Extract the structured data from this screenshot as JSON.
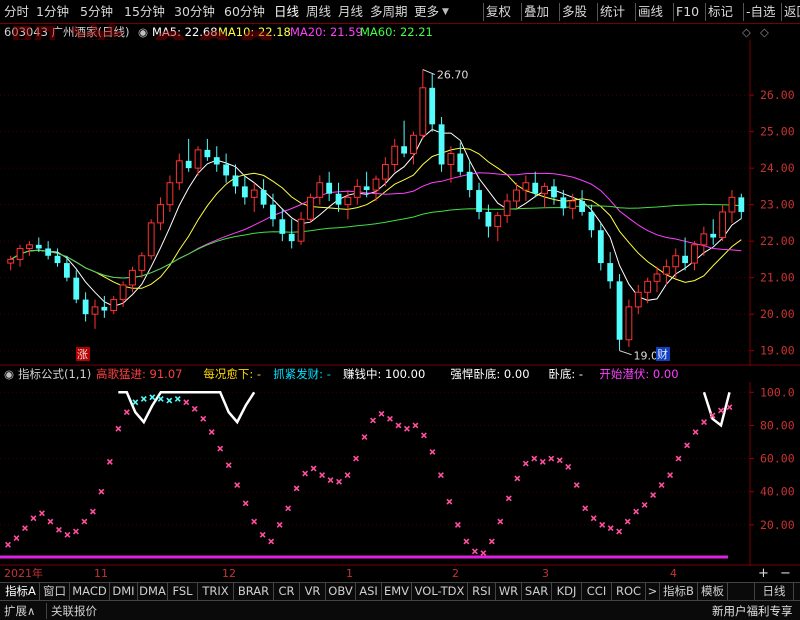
{
  "toolbar": {
    "items": [
      "分时",
      "1分钟",
      "5分钟",
      "15分钟",
      "30分钟",
      "60分钟",
      "日线",
      "周线",
      "月线",
      "多周期",
      "更多"
    ],
    "right_items": [
      "复权",
      "叠加",
      "多股",
      "统计",
      "画线",
      "F10",
      "标记",
      "-自选",
      "返回"
    ]
  },
  "stock": {
    "code_name": "603043 广州酒家(日线)",
    "ma5": "MA5: 22.68",
    "ma10": "MA10: 22.18",
    "ma20": "MA20: 21.59",
    "ma60": "MA60: 22.21"
  },
  "watermark": "股道 908.cn",
  "price_axis": [
    "26.00",
    "25.00",
    "24.00",
    "23.00",
    "22.00",
    "21.00",
    "20.00",
    "19.00"
  ],
  "annotations": {
    "high": "26.70",
    "low": "19.00",
    "zhang": "涨",
    "cai": "财"
  },
  "indicator": {
    "title": "指标公式(1,1)",
    "parts": [
      {
        "label": "高歌猛进:",
        "value": "91.07",
        "color": "#ff4040"
      },
      {
        "label": "每况愈下:",
        "value": "-",
        "color": "#ffd700"
      },
      {
        "label": "抓紧发财:",
        "value": "-",
        "color": "#00e0ff"
      },
      {
        "label": "赚钱中:",
        "value": "100.00",
        "color": "#ffffff"
      },
      {
        "label": "强悍卧底:",
        "value": "0.00",
        "color": "#ffffff"
      },
      {
        "label": "卧底:",
        "value": "-",
        "color": "#ffffff"
      },
      {
        "label": "开始潜伏:",
        "value": "0.00",
        "color": "#ff40ff"
      }
    ],
    "axis": [
      "100.0",
      "80.00",
      "60.00",
      "40.00",
      "20.00"
    ]
  },
  "time_axis": [
    "2021年",
    "11",
    "12",
    "1",
    "2",
    "3",
    "4"
  ],
  "tabs": [
    "指标A",
    "窗口",
    "MACD",
    "DMI",
    "DMA",
    "FSL",
    "TRIX",
    "BRAR",
    "CR",
    "VR",
    "OBV",
    "ASI",
    "EMV",
    "VOL-TDX",
    "RSI",
    "WR",
    "SAR",
    "KDJ",
    "CCI",
    "ROC",
    ">",
    "指标B",
    "模板",
    "日线"
  ],
  "bottom": {
    "left1": "扩展∧",
    "left2": "关联报价",
    "right": "新用户福利专享"
  },
  "chart_data": {
    "type": "candlestick",
    "price_range": [
      18.8,
      27.4
    ],
    "indicator_range": [
      0,
      105
    ],
    "candles": [
      [
        21.4,
        21.6,
        21.2,
        21.5
      ],
      [
        21.5,
        21.9,
        21.3,
        21.8
      ],
      [
        21.8,
        22.0,
        21.6,
        21.9
      ],
      [
        21.9,
        22.1,
        21.7,
        21.8
      ],
      [
        21.8,
        22.0,
        21.5,
        21.6
      ],
      [
        21.6,
        21.8,
        21.3,
        21.4
      ],
      [
        21.4,
        21.6,
        20.9,
        21.0
      ],
      [
        21.0,
        21.2,
        20.3,
        20.4
      ],
      [
        20.4,
        20.6,
        19.8,
        20.0
      ],
      [
        20.0,
        20.4,
        19.6,
        20.2
      ],
      [
        20.2,
        20.5,
        19.9,
        20.1
      ],
      [
        20.1,
        20.5,
        20.0,
        20.4
      ],
      [
        20.4,
        20.9,
        20.2,
        20.8
      ],
      [
        20.8,
        21.3,
        20.6,
        21.2
      ],
      [
        21.2,
        21.7,
        21.0,
        21.6
      ],
      [
        21.6,
        22.6,
        21.5,
        22.5
      ],
      [
        22.5,
        23.2,
        22.3,
        23.0
      ],
      [
        23.0,
        23.8,
        22.8,
        23.6
      ],
      [
        23.6,
        24.4,
        23.4,
        24.2
      ],
      [
        24.2,
        24.8,
        23.9,
        24.0
      ],
      [
        24.0,
        24.6,
        23.8,
        24.5
      ],
      [
        24.5,
        24.8,
        24.2,
        24.3
      ],
      [
        24.3,
        24.6,
        23.9,
        24.1
      ],
      [
        24.1,
        24.4,
        23.6,
        23.8
      ],
      [
        23.8,
        24.1,
        23.3,
        23.5
      ],
      [
        23.5,
        23.8,
        23.0,
        23.2
      ],
      [
        23.2,
        23.6,
        22.8,
        23.4
      ],
      [
        23.4,
        23.7,
        22.9,
        23.0
      ],
      [
        23.0,
        23.3,
        22.4,
        22.6
      ],
      [
        22.6,
        22.9,
        22.0,
        22.2
      ],
      [
        22.2,
        22.6,
        21.8,
        22.0
      ],
      [
        22.0,
        22.8,
        21.9,
        22.6
      ],
      [
        22.6,
        23.3,
        22.5,
        23.2
      ],
      [
        23.2,
        23.8,
        23.0,
        23.6
      ],
      [
        23.6,
        23.9,
        23.1,
        23.3
      ],
      [
        23.3,
        23.6,
        22.8,
        23.0
      ],
      [
        23.0,
        23.4,
        22.6,
        23.2
      ],
      [
        23.2,
        23.7,
        23.0,
        23.5
      ],
      [
        23.5,
        23.9,
        23.2,
        23.4
      ],
      [
        23.4,
        23.8,
        23.1,
        23.7
      ],
      [
        23.7,
        24.3,
        23.5,
        24.1
      ],
      [
        24.1,
        24.8,
        23.9,
        24.6
      ],
      [
        24.6,
        25.3,
        24.3,
        24.4
      ],
      [
        24.4,
        25.0,
        24.1,
        24.9
      ],
      [
        24.9,
        26.7,
        24.8,
        26.2
      ],
      [
        26.2,
        26.6,
        25.0,
        25.2
      ],
      [
        25.2,
        25.4,
        23.9,
        24.1
      ],
      [
        24.1,
        24.6,
        23.6,
        24.4
      ],
      [
        24.4,
        24.7,
        23.8,
        23.9
      ],
      [
        23.9,
        24.2,
        23.2,
        23.4
      ],
      [
        23.4,
        23.6,
        22.6,
        22.8
      ],
      [
        22.8,
        23.0,
        22.1,
        22.4
      ],
      [
        22.4,
        22.8,
        22.0,
        22.7
      ],
      [
        22.7,
        23.3,
        22.5,
        23.1
      ],
      [
        23.1,
        23.6,
        22.9,
        23.4
      ],
      [
        23.4,
        23.8,
        23.1,
        23.6
      ],
      [
        23.6,
        23.9,
        23.2,
        23.3
      ],
      [
        23.3,
        23.6,
        22.9,
        23.5
      ],
      [
        23.5,
        23.7,
        23.0,
        23.2
      ],
      [
        23.2,
        23.4,
        22.7,
        22.9
      ],
      [
        22.9,
        23.3,
        22.6,
        23.1
      ],
      [
        23.1,
        23.4,
        22.7,
        22.8
      ],
      [
        22.8,
        23.0,
        22.1,
        22.3
      ],
      [
        22.3,
        22.5,
        21.2,
        21.4
      ],
      [
        21.4,
        21.7,
        20.7,
        20.9
      ],
      [
        20.9,
        21.1,
        19.0,
        19.3
      ],
      [
        19.3,
        20.4,
        19.1,
        20.2
      ],
      [
        20.2,
        20.8,
        20.0,
        20.6
      ],
      [
        20.6,
        21.0,
        20.3,
        20.9
      ],
      [
        20.9,
        21.3,
        20.6,
        21.1
      ],
      [
        21.1,
        21.5,
        20.8,
        21.3
      ],
      [
        21.3,
        21.8,
        21.0,
        21.6
      ],
      [
        21.6,
        22.1,
        21.2,
        21.4
      ],
      [
        21.4,
        22.0,
        21.2,
        21.9
      ],
      [
        21.9,
        22.4,
        21.6,
        22.2
      ],
      [
        22.2,
        22.6,
        21.9,
        22.1
      ],
      [
        22.1,
        23.0,
        22.0,
        22.8
      ],
      [
        22.8,
        23.4,
        22.5,
        23.2
      ],
      [
        23.2,
        23.3,
        22.6,
        22.8
      ]
    ],
    "indicator": [
      8,
      12,
      18,
      24,
      27,
      22,
      17,
      14,
      16,
      22,
      28,
      40,
      58,
      78,
      88,
      94,
      96,
      97,
      96,
      95,
      96,
      94,
      90,
      84,
      76,
      66,
      56,
      44,
      33,
      22,
      14,
      10,
      20,
      30,
      42,
      51,
      54,
      50,
      47,
      46,
      50,
      60,
      73,
      83,
      87,
      84,
      80,
      78,
      80,
      74,
      64,
      50,
      34,
      20,
      10,
      4,
      3,
      10,
      22,
      36,
      48,
      57,
      60,
      58,
      60,
      59,
      55,
      44,
      30,
      24,
      20,
      18,
      16,
      22,
      28,
      32,
      38,
      44,
      50,
      60,
      68,
      76,
      82,
      86,
      89,
      91
    ]
  }
}
